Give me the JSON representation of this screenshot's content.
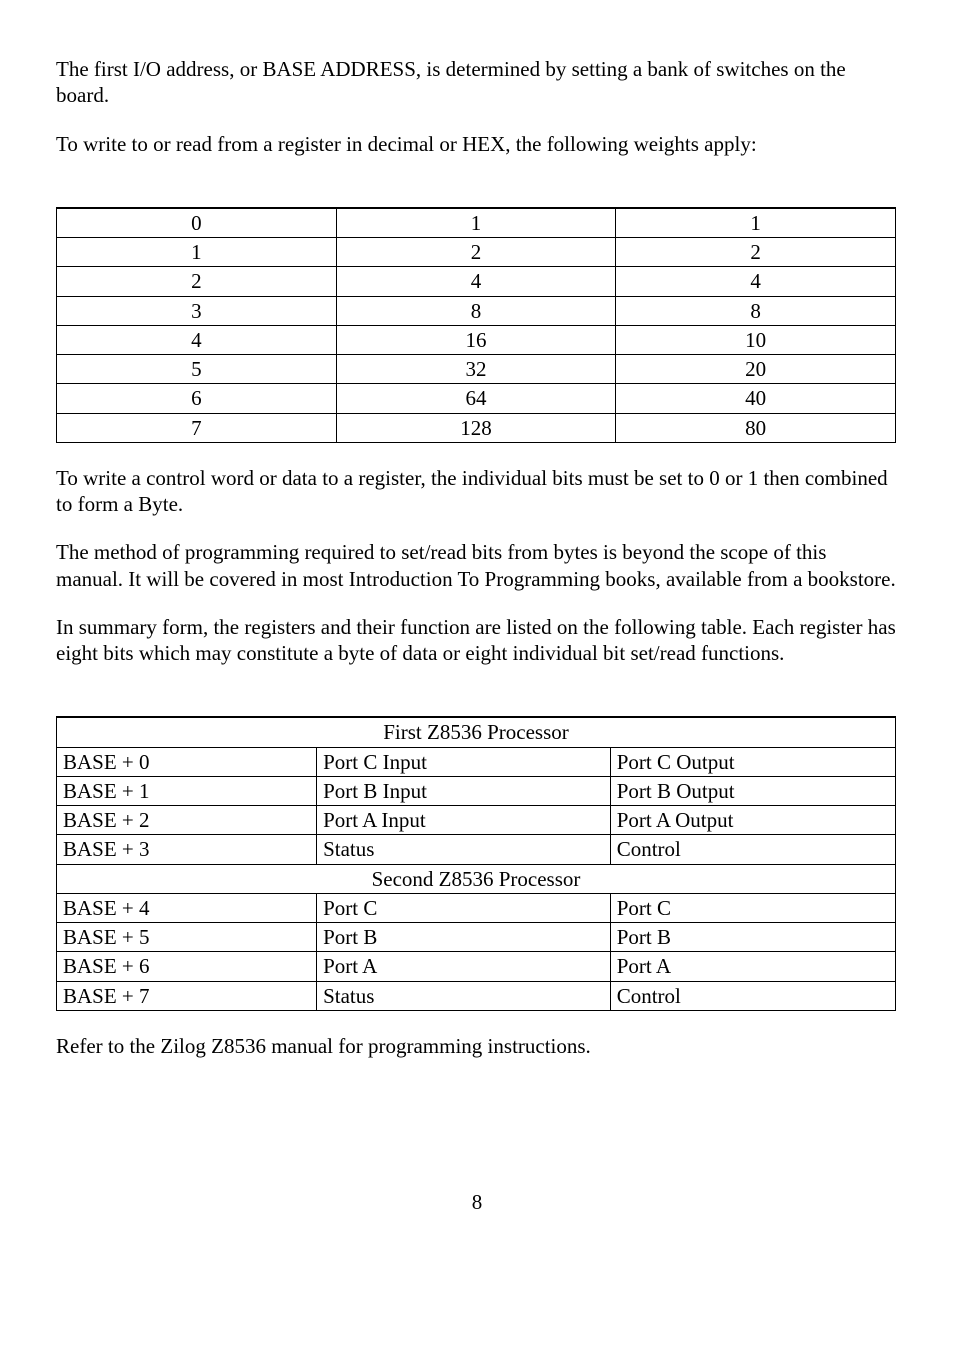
{
  "p1": "The first I/O address, or BASE ADDRESS, is determined by setting a bank of switches on the board.",
  "p2": "To write to or read from a register in decimal or HEX, the following weights apply:",
  "table1": {
    "h1": "",
    "h2": "",
    "h3": "",
    "rows": [
      {
        "c1": "0",
        "c2": "1",
        "c3": "1"
      },
      {
        "c1": "1",
        "c2": "2",
        "c3": "2"
      },
      {
        "c1": "2",
        "c2": "4",
        "c3": "4"
      },
      {
        "c1": "3",
        "c2": "8",
        "c3": "8"
      },
      {
        "c1": "4",
        "c2": "16",
        "c3": "10"
      },
      {
        "c1": "5",
        "c2": "32",
        "c3": "20"
      },
      {
        "c1": "6",
        "c2": "64",
        "c3": "40"
      },
      {
        "c1": "7",
        "c2": "128",
        "c3": "80"
      }
    ]
  },
  "p3": "To write a control word or data to a register, the individual bits must be set to 0 or 1 then combined to form a Byte.",
  "p4": "The method of programming required to set/read bits from bytes is beyond the scope of this manual.  It will be covered in most Introduction To Programming books, available from a bookstore.",
  "p5": "In summary form, the registers and their function are listed on the following table.  Each register has eight bits which may constitute a byte of data or eight individual bit set/read functions.",
  "table2": {
    "h1": "",
    "h2": "",
    "h3": "",
    "section1": "First Z8536 Processor",
    "rows1": [
      {
        "c1": "BASE + 0",
        "c2": "Port C Input",
        "c3": "Port C Output"
      },
      {
        "c1": "BASE + 1",
        "c2": "Port B Input",
        "c3": "Port B Output"
      },
      {
        "c1": "BASE + 2",
        "c2": "Port A Input",
        "c3": "Port A Output"
      },
      {
        "c1": "BASE + 3",
        "c2": "Status",
        "c3": "Control"
      }
    ],
    "section2": "Second Z8536 Processor",
    "rows2": [
      {
        "c1": "BASE + 4",
        "c2": "Port C",
        "c3": "Port C"
      },
      {
        "c1": "BASE + 5",
        "c2": "Port B",
        "c3": "Port B"
      },
      {
        "c1": "BASE + 6",
        "c2": "Port A",
        "c3": "Port A"
      },
      {
        "c1": "BASE + 7",
        "c2": "Status",
        "c3": "Control"
      }
    ]
  },
  "p6": "Refer to the Zilog Z8536 manual for programming instructions.",
  "page_number": "8"
}
